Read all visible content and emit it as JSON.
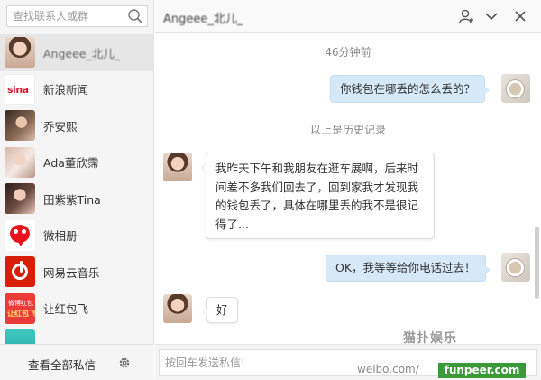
{
  "search": {
    "placeholder": "查找联系人或群"
  },
  "contacts": [
    {
      "name": "Angeee_北儿_",
      "avatar": "girl-avatar",
      "active": true
    },
    {
      "name": "新浪新闻",
      "avatar": "sina-logo"
    },
    {
      "name": "乔安熙",
      "avatar": "portrait-avatar"
    },
    {
      "name": "Ada董欣霈",
      "avatar": "portrait-avatar"
    },
    {
      "name": "田紫紫Tina",
      "avatar": "portrait-avatar"
    },
    {
      "name": "微相册",
      "avatar": "micro-album-logo"
    },
    {
      "name": "网易云音乐",
      "avatar": "netease-music-logo"
    },
    {
      "name": "让红包飞",
      "avatar": "red-packet-logo",
      "logo_text": [
        "微博红包",
        "让红包飞"
      ]
    },
    {
      "name": "",
      "avatar": "teal-avatar"
    }
  ],
  "footer": {
    "view_all": "查看全部私信"
  },
  "chat": {
    "title": "Angeee_北儿_",
    "messages": [
      {
        "type": "time",
        "text": "46分钟前"
      },
      {
        "type": "outgoing",
        "text": "你钱包在哪丢的怎么丢的？"
      },
      {
        "type": "time",
        "text": "以上是历史记录"
      },
      {
        "type": "incoming",
        "lines": [
          "我昨天下午和我朋友在逛车展啊，后来时",
          "间差不多我们回去了，回到家我才发现我",
          "的钱包丢了，具体在哪里丢的我不是很记",
          "得了..."
        ]
      },
      {
        "type": "outgoing",
        "text": "OK，我等等给你电话过去！"
      },
      {
        "type": "incoming",
        "text": "好"
      }
    ],
    "input_placeholder": "按回车发送私信!"
  },
  "watermarks": {
    "site_logo": "猫扑娱乐",
    "weibo": "weibo.com/",
    "funpeer": "funpeer.com"
  },
  "colors": {
    "outgoing_bubble": "#d5e9f9",
    "incoming_bubble": "#ffffff",
    "sidebar_bg": "#f5f5f5",
    "accent_red": "#e6162d"
  }
}
